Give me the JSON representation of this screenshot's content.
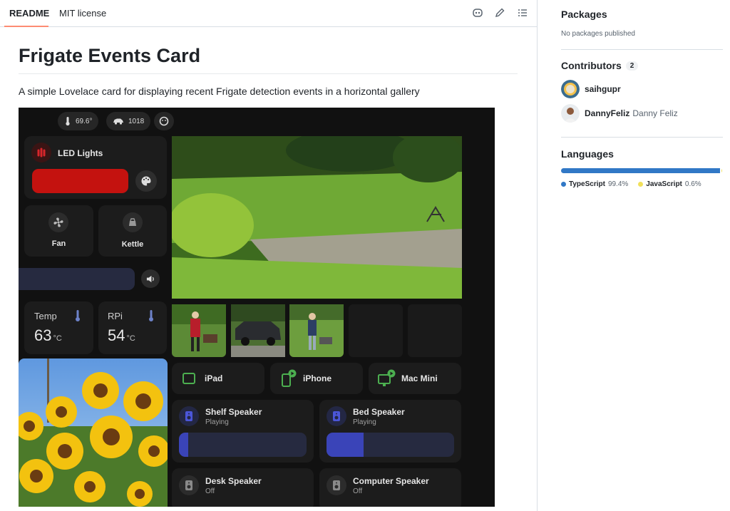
{
  "tabs": [
    {
      "label": "README",
      "active": true
    },
    {
      "label": "MIT license",
      "active": false
    }
  ],
  "toolbar_icons": [
    "copilot-icon",
    "pencil-icon",
    "list-icon"
  ],
  "readme": {
    "title": "Frigate Events Card",
    "description": "A simple Lovelace card for displaying recent Frigate detection events in a horizontal gallery"
  },
  "dashboard": {
    "chips": [
      {
        "icon": "thermometer-icon",
        "text": "69.6°"
      },
      {
        "icon": "car-icon",
        "text": "1018"
      },
      {
        "icon": "face-icon",
        "text": ""
      }
    ],
    "led_lights_label": "LED Lights",
    "led_color": "#c4120f",
    "fan_label": "Fan",
    "kettle_label": "Kettle",
    "temp": {
      "label": "Temp",
      "value": "63",
      "unit": "°C"
    },
    "rpi": {
      "label": "RPi",
      "value": "54",
      "unit": "°C"
    },
    "devices": [
      {
        "label": "iPad",
        "icon": "tablet-icon"
      },
      {
        "label": "iPhone",
        "icon": "phone-icon"
      },
      {
        "label": "Mac Mini",
        "icon": "monitor-icon"
      }
    ],
    "speakers": [
      {
        "name": "Shelf Speaker",
        "status": "Playing",
        "volume": 0.07
      },
      {
        "name": "Bed Speaker",
        "status": "Playing",
        "volume": 0.29
      },
      {
        "name": "Desk Speaker",
        "status": "Off"
      },
      {
        "name": "Computer Speaker",
        "status": "Off"
      }
    ],
    "accent_blue": "#3a44b8",
    "green": "#4caf50"
  },
  "sidebar": {
    "packages": {
      "heading": "Packages",
      "text": "No packages published"
    },
    "contributors": {
      "heading": "Contributors",
      "count": "2",
      "people": [
        {
          "login": "saihgupr",
          "name": ""
        },
        {
          "login": "DannyFeliz",
          "name": "Danny Feliz"
        }
      ]
    },
    "languages": {
      "heading": "Languages",
      "items": [
        {
          "name": "TypeScript",
          "percent": "99.4%",
          "share": 0.994,
          "color": "#3178c6"
        },
        {
          "name": "JavaScript",
          "percent": "0.6%",
          "share": 0.006,
          "color": "#f1e05a"
        }
      ]
    }
  }
}
